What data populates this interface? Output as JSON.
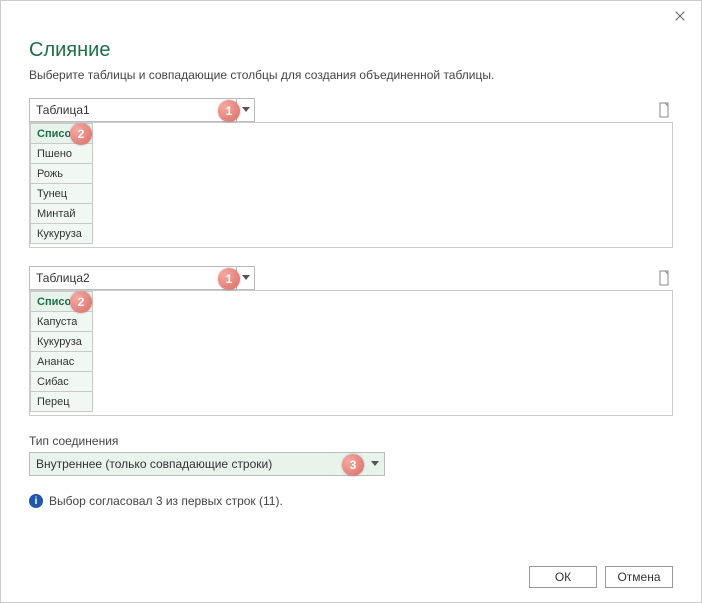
{
  "dialog": {
    "title": "Слияние",
    "subtitle": "Выберите таблицы и совпадающие столбцы для создания объединенной таблицы."
  },
  "table1": {
    "selected": "Таблица1",
    "header": "Список1",
    "rows": [
      "Пшено",
      "Рожь",
      "Тунец",
      "Минтай",
      "Кукуруза"
    ]
  },
  "table2": {
    "selected": "Таблица2",
    "header": "Список2",
    "rows": [
      "Капуста",
      "Кукуруза",
      "Ананас",
      "Сибас",
      "Перец"
    ]
  },
  "join": {
    "label": "Тип соединения",
    "selected": "Внутреннее (только совпадающие строки)"
  },
  "status": "Выбор согласовал 3 из первых строк (11).",
  "buttons": {
    "ok": "ОК",
    "cancel": "Отмена"
  },
  "badges": {
    "b1": "1",
    "b2": "2",
    "b3": "1",
    "b4": "2",
    "b5": "3"
  }
}
